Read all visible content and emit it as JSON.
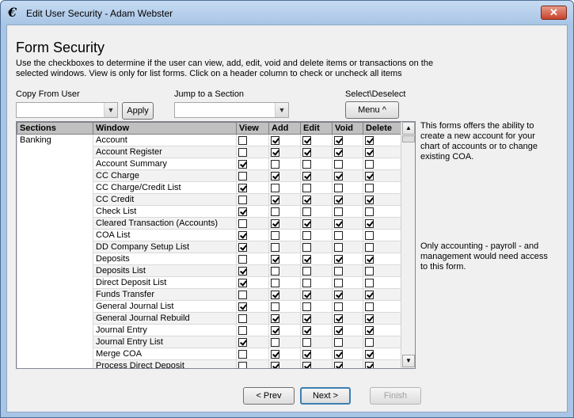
{
  "window": {
    "title": "Edit User Security - Adam Webster",
    "app_icon": "€",
    "close_glyph": "✕"
  },
  "page": {
    "title": "Form Security",
    "description": "Use the checkboxes to determine if the user can view, add, edit, void and delete items or transactions on the selected windows.  View is only for list forms.  Click on a header column to check or uncheck all items"
  },
  "controls": {
    "copy_from_label": "Copy From User",
    "copy_from_value": "",
    "apply_label": "Apply",
    "jump_label": "Jump to a Section",
    "jump_value": "",
    "select_label": "Select\\Deselect",
    "menu_label": "Menu ^"
  },
  "grid": {
    "headers": {
      "section": "Sections",
      "window": "Window",
      "view": "View",
      "add": "Add",
      "edit": "Edit",
      "void": "Void",
      "delete": "Delete"
    },
    "rows": [
      {
        "section": "Banking",
        "window": "Account",
        "view": false,
        "add": true,
        "edit": true,
        "void": true,
        "del": true
      },
      {
        "section": "",
        "window": "Account Register",
        "view": false,
        "add": true,
        "edit": true,
        "void": true,
        "del": true
      },
      {
        "section": "",
        "window": "Account Summary",
        "view": true,
        "add": false,
        "edit": false,
        "void": false,
        "del": false
      },
      {
        "section": "",
        "window": "CC Charge",
        "view": false,
        "add": true,
        "edit": true,
        "void": true,
        "del": true
      },
      {
        "section": "",
        "window": "CC Charge/Credit List",
        "view": true,
        "add": false,
        "edit": false,
        "void": false,
        "del": false
      },
      {
        "section": "",
        "window": "CC Credit",
        "view": false,
        "add": true,
        "edit": true,
        "void": true,
        "del": true
      },
      {
        "section": "",
        "window": "Check List",
        "view": true,
        "add": false,
        "edit": false,
        "void": false,
        "del": false
      },
      {
        "section": "",
        "window": "Cleared Transaction (Accounts)",
        "view": false,
        "add": true,
        "edit": true,
        "void": true,
        "del": true
      },
      {
        "section": "",
        "window": "COA List",
        "view": true,
        "add": false,
        "edit": false,
        "void": false,
        "del": false
      },
      {
        "section": "",
        "window": "DD Company Setup List",
        "view": true,
        "add": false,
        "edit": false,
        "void": false,
        "del": false
      },
      {
        "section": "",
        "window": "Deposits",
        "view": false,
        "add": true,
        "edit": true,
        "void": true,
        "del": true
      },
      {
        "section": "",
        "window": "Deposits List",
        "view": true,
        "add": false,
        "edit": false,
        "void": false,
        "del": false
      },
      {
        "section": "",
        "window": "Direct Deposit List",
        "view": true,
        "add": false,
        "edit": false,
        "void": false,
        "del": false
      },
      {
        "section": "",
        "window": "Funds Transfer",
        "view": false,
        "add": true,
        "edit": true,
        "void": true,
        "del": true
      },
      {
        "section": "",
        "window": "General Journal List",
        "view": true,
        "add": false,
        "edit": false,
        "void": false,
        "del": false
      },
      {
        "section": "",
        "window": "General Journal Rebuild",
        "view": false,
        "add": true,
        "edit": true,
        "void": true,
        "del": true
      },
      {
        "section": "",
        "window": "Journal Entry",
        "view": false,
        "add": true,
        "edit": true,
        "void": true,
        "del": true
      },
      {
        "section": "",
        "window": "Journal Entry List",
        "view": true,
        "add": false,
        "edit": false,
        "void": false,
        "del": false
      },
      {
        "section": "",
        "window": "Merge COA",
        "view": false,
        "add": true,
        "edit": true,
        "void": true,
        "del": true
      },
      {
        "section": "",
        "window": "Process Direct Deposit",
        "view": false,
        "add": true,
        "edit": true,
        "void": true,
        "del": true
      }
    ]
  },
  "notes": {
    "note1": "This forms offers the ability to create a new account for your chart of accounts or to change existing COA.",
    "note2": "Only accounting - payroll - and management would need access to this form."
  },
  "footer": {
    "prev_label": "< Prev",
    "next_label": "Next >",
    "finish_label": "Finish"
  }
}
